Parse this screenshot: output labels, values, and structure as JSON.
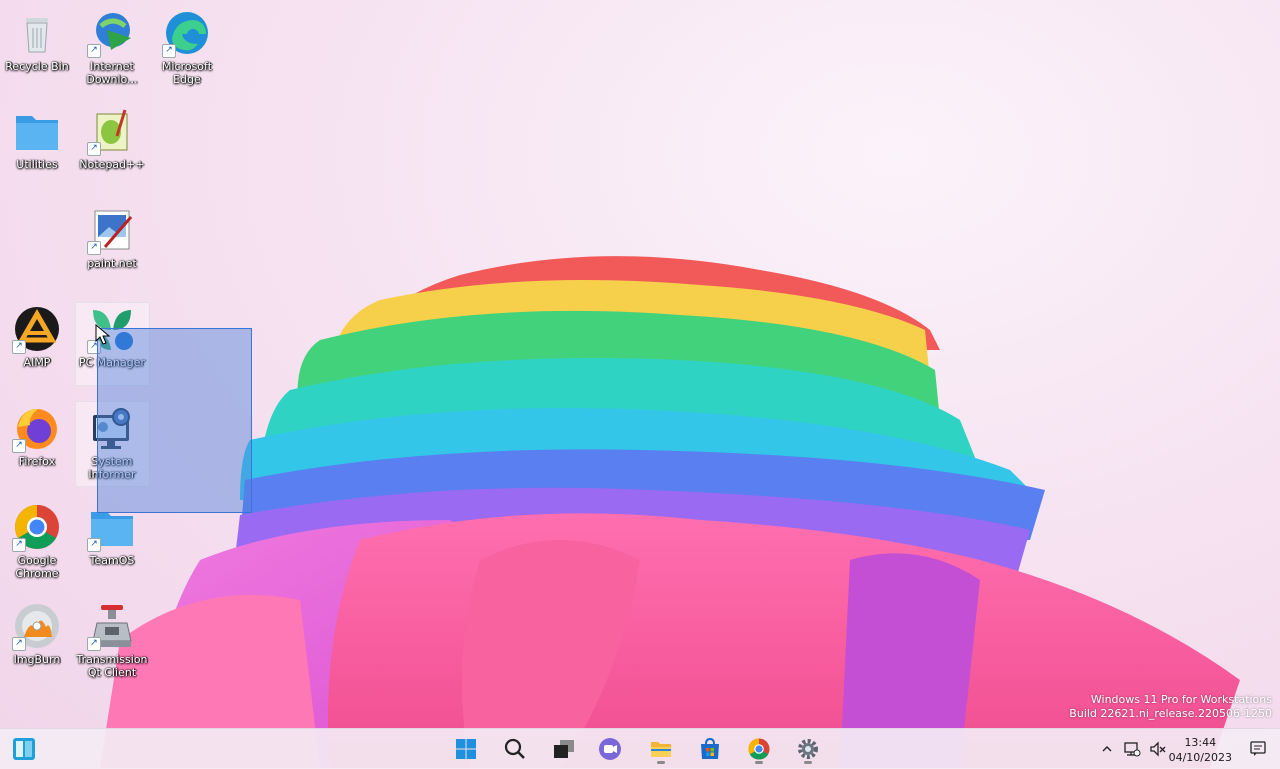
{
  "desktop": {
    "icons": [
      {
        "label": "Recycle Bin",
        "icon": "recycle-bin-icon"
      },
      {
        "label": "Internet Downlo...",
        "icon": "internet-download-manager-icon"
      },
      {
        "label": "Microsoft Edge",
        "icon": "edge-icon"
      },
      {
        "label": "Utilities",
        "icon": "folder-icon"
      },
      {
        "label": "Notepad++",
        "icon": "notepad-plus-plus-icon"
      },
      {
        "label": "paint.net",
        "icon": "paint-net-icon"
      },
      {
        "label": "AIMP",
        "icon": "aimp-icon"
      },
      {
        "label": "PC Manager",
        "icon": "pc-manager-icon"
      },
      {
        "label": "Firefox",
        "icon": "firefox-icon"
      },
      {
        "label": "System Informer",
        "icon": "system-informer-icon"
      },
      {
        "label": "Google Chrome",
        "icon": "chrome-icon"
      },
      {
        "label": "TeamOS",
        "icon": "folder-icon"
      },
      {
        "label": "ImgBurn",
        "icon": "imgburn-icon"
      },
      {
        "label": "Transmission Qt Client",
        "icon": "transmission-icon"
      }
    ]
  },
  "watermark": {
    "line1": "Windows 11 Pro for Workstations",
    "line2": "Build 22621.ni_release.220506-1250"
  },
  "taskbar": {
    "buttons": [
      {
        "name": "widgets",
        "icon": "widgets-icon"
      },
      {
        "name": "start",
        "icon": "windows-logo-icon"
      },
      {
        "name": "search",
        "icon": "search-icon"
      },
      {
        "name": "task-view",
        "icon": "task-view-icon"
      },
      {
        "name": "teams-chat",
        "icon": "teams-chat-icon"
      },
      {
        "name": "file-explorer",
        "icon": "file-explorer-icon"
      },
      {
        "name": "microsoft-store",
        "icon": "store-icon"
      },
      {
        "name": "chrome",
        "icon": "chrome-icon"
      },
      {
        "name": "settings",
        "icon": "gear-icon"
      }
    ],
    "tray": {
      "chevron": "chevron-up-icon",
      "network": "network-icon",
      "volume": "volume-muted-icon",
      "notifications": "notification-icon"
    },
    "clock": {
      "time": "13:44",
      "date": "04/10/2023"
    }
  },
  "colors": {
    "selection": "#3a74d6",
    "accent": "#0078d4"
  }
}
